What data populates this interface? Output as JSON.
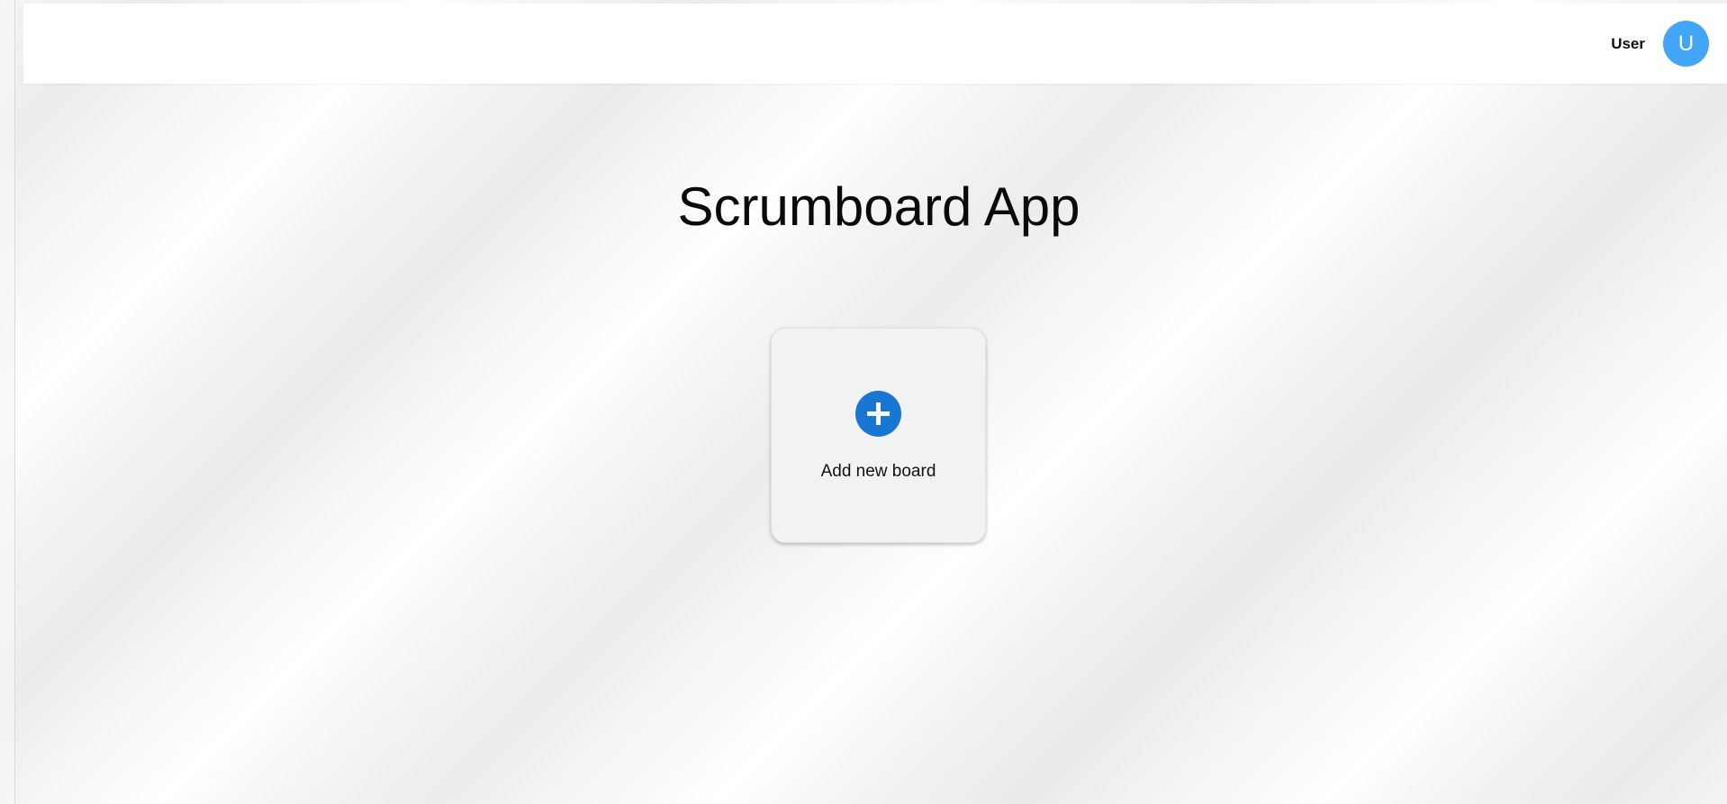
{
  "header": {
    "user_label": "User",
    "avatar_initial": "U",
    "avatar_color": "#42a5f5"
  },
  "main": {
    "title": "Scrumboard App",
    "add_board": {
      "label": "Add new board",
      "icon": "add-circle-icon",
      "icon_color": "#1976d2"
    }
  }
}
